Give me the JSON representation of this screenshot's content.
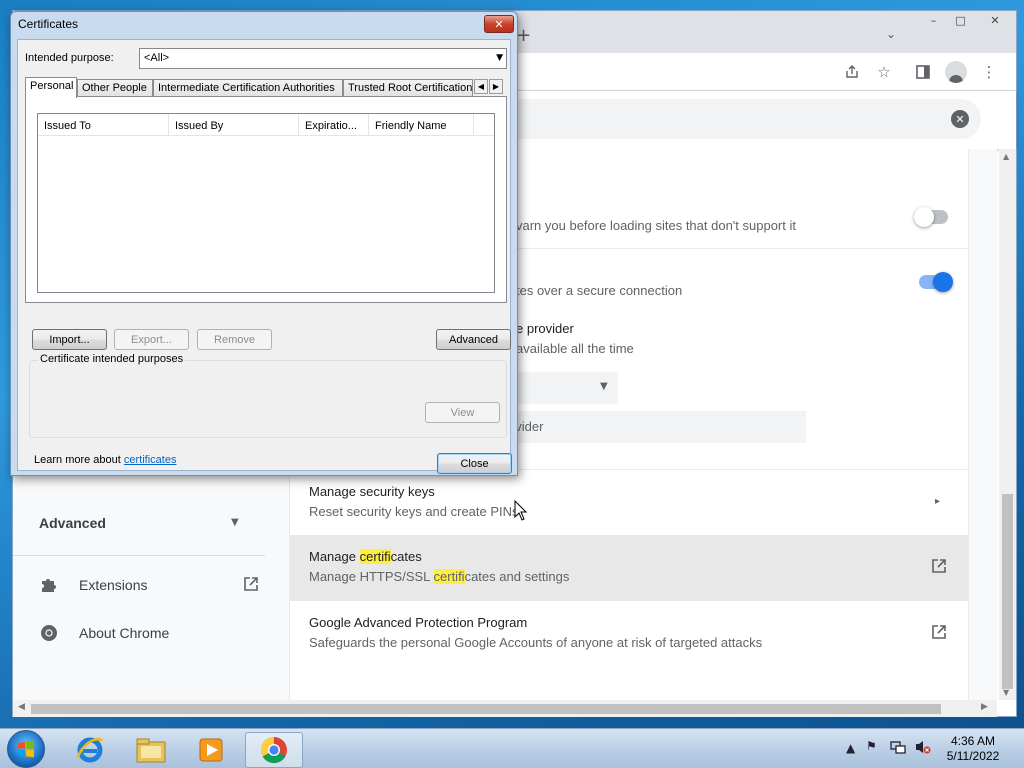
{
  "colors": {
    "accent": "#1a73e8",
    "highlight": "#fdef3d",
    "desktop": "#1f86cf"
  },
  "chrome": {
    "titlebar": {
      "new_tab_icon": "plus-icon",
      "tab_search_icon": "chevron-down-icon"
    },
    "toolbar": {
      "icons": [
        "share-icon",
        "star-icon",
        "side-panel-icon",
        "profile-icon",
        "menu-icon"
      ]
    },
    "search": {
      "clear_icon": "clear-icon"
    }
  },
  "settings": {
    "left_nav": {
      "advanced_label": "Advanced",
      "extensions_label": "Extensions",
      "about_label": "About Chrome"
    },
    "rows": {
      "https_warning_desc": "varn you before loading sites that don't support it",
      "secure_dns_desc": "tes over a secure connection",
      "provider_title": "e provider",
      "provider_desc": "available all the time",
      "custom_provider_placeholder": "ovider",
      "security_keys_title": "Manage security keys",
      "security_keys_desc": "Reset security keys and create PINs",
      "manage_certs_title_pre": "Manage ",
      "manage_certs_title_hl": "certifi",
      "manage_certs_title_post": "cates",
      "manage_certs_desc_pre": "Manage HTTPS/SSL ",
      "manage_certs_desc_hl": "certifi",
      "manage_certs_desc_post": "cates and settings",
      "gapp_title": "Google Advanced Protection Program",
      "gapp_desc": "Safeguards the personal Google Accounts of anyone at risk of targeted attacks"
    },
    "toggles": {
      "https_only": false,
      "secure_dns": true
    }
  },
  "cert_dialog": {
    "title": "Certificates",
    "intended_purpose_label": "Intended purpose:",
    "intended_purpose_value": "<All>",
    "tabs": [
      {
        "label": "Personal",
        "active": true
      },
      {
        "label": "Other People",
        "active": false
      },
      {
        "label": "Intermediate Certification Authorities",
        "active": false
      },
      {
        "label": "Trusted Root Certification Authorities",
        "active": false
      }
    ],
    "columns": [
      "Issued To",
      "Issued By",
      "Expiratio...",
      "Friendly Name"
    ],
    "buttons": {
      "import": "Import...",
      "export": "Export...",
      "remove": "Remove",
      "advanced": "Advanced",
      "view": "View",
      "close": "Close"
    },
    "purposes_group_label": "Certificate intended purposes",
    "learn_more_text": "Learn more about ",
    "learn_more_link": "certificates"
  },
  "taskbar": {
    "pinned": [
      "internet-explorer-icon",
      "file-explorer-icon",
      "media-player-icon",
      "chrome-icon"
    ],
    "time": "4:36 AM",
    "date": "5/11/2022"
  }
}
